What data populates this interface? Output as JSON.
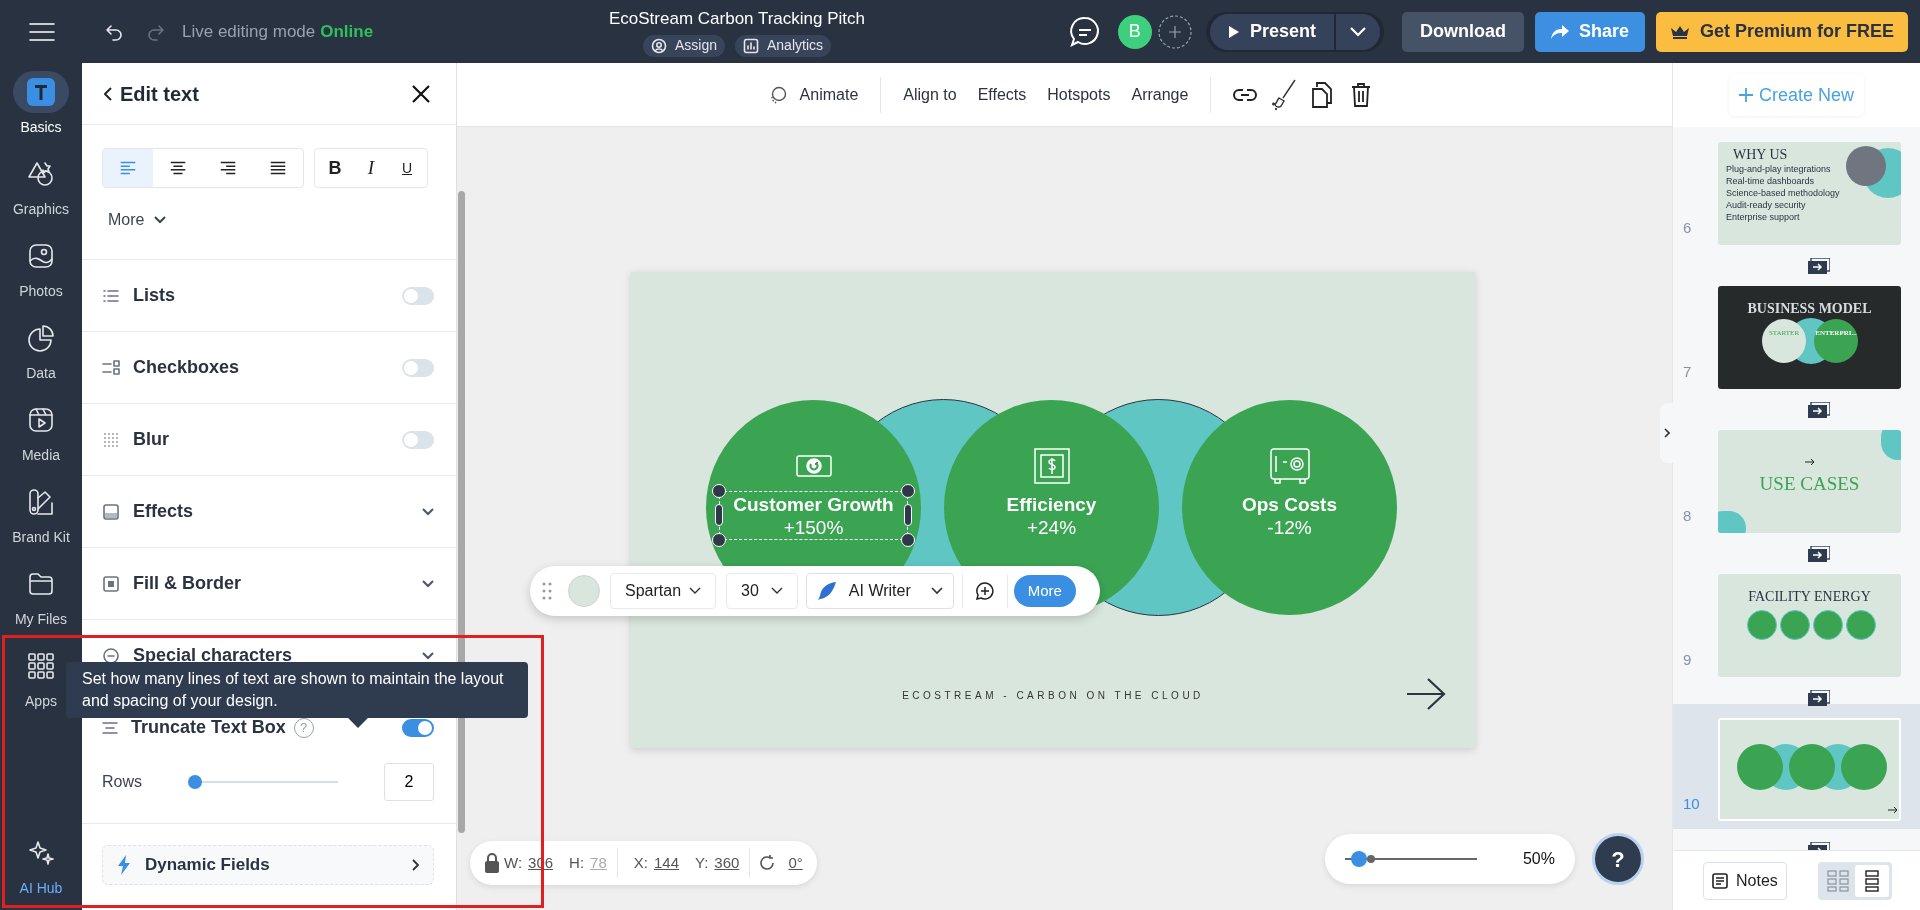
{
  "topbar": {
    "live_label": "Live editing mode",
    "live_status": "Online",
    "title": "EcoStream Carbon Tracking Pitch",
    "chips": [
      "Assign",
      "Analytics"
    ],
    "avatar": "B",
    "present": "Present",
    "download": "Download",
    "share": "Share",
    "premium": "Get Premium for FREE"
  },
  "rail": [
    {
      "label": "Basics",
      "selected": true
    },
    {
      "label": "Graphics",
      "selected": false
    },
    {
      "label": "Photos",
      "selected": false
    },
    {
      "label": "Data",
      "selected": false
    },
    {
      "label": "Media",
      "selected": false
    },
    {
      "label": "Brand Kit",
      "selected": false
    },
    {
      "label": "My Files",
      "selected": false
    },
    {
      "label": "Apps",
      "selected": false
    },
    {
      "label": "AI Hub",
      "selected": false
    }
  ],
  "panel": {
    "title": "Edit text",
    "align_buttons": [
      {
        "selected": true
      },
      {
        "selected": false
      },
      {
        "selected": false
      },
      {
        "selected": false
      }
    ],
    "style_buttons": [
      "B",
      "I",
      "U"
    ],
    "more": "More",
    "sections": [
      {
        "kind": "toggle",
        "label": "Lists",
        "on": false
      },
      {
        "kind": "toggle",
        "label": "Checkboxes",
        "on": false
      },
      {
        "kind": "toggle",
        "label": "Blur",
        "on": false
      },
      {
        "kind": "expand",
        "label": "Effects"
      },
      {
        "kind": "expand",
        "label": "Fill & Border"
      },
      {
        "kind": "expand",
        "label": "Special characters"
      }
    ],
    "truncate": {
      "label": "Truncate Text Box",
      "help": "?",
      "on": true
    },
    "rows": {
      "label": "Rows",
      "level": 0,
      "value": "2"
    },
    "dynamic_fields": "Dynamic Fields"
  },
  "tooltip": "Set how many lines of text are shown to maintain the layout and spacing of your design.",
  "toolbar": {
    "animate": "Animate",
    "items": [
      "Align to",
      "Effects",
      "Hotspots",
      "Arrange"
    ]
  },
  "slide": {
    "stats": [
      {
        "title": "Customer Growth",
        "value": "+150%",
        "selected": true
      },
      {
        "title": "Efficiency",
        "value": "+24%",
        "selected": false
      },
      {
        "title": "Ops Costs",
        "value": "-12%",
        "selected": false
      }
    ],
    "footer": "ECOSTREAM - CARBON ON THE CLOUD"
  },
  "text_toolbar": {
    "font": "Spartan",
    "size": "30",
    "ai": "AI Writer",
    "more": "More"
  },
  "geometry": [
    {
      "label": "W:",
      "value": "306",
      "disabled": false
    },
    {
      "label": "H:",
      "value": "78",
      "disabled": true
    },
    {
      "label": "X:",
      "value": "144",
      "disabled": false
    },
    {
      "label": "Y:",
      "value": "360",
      "disabled": false
    }
  ],
  "rotation": "0°",
  "zoom": {
    "level": 0.05,
    "reading": "50%"
  },
  "help": "?",
  "slides_panel": {
    "create": "Create New",
    "slides": [
      {
        "number": "6",
        "selected": false,
        "kind": "why_us",
        "title": "WHY US",
        "lines": [
          "Plug-and-play integrations",
          "Real-time dashboards",
          "Science-based methodology",
          "Audit-ready security",
          "Enterprise support"
        ]
      },
      {
        "number": "7",
        "selected": false,
        "kind": "business",
        "title": "BUSINESS MODEL",
        "labels": [
          "STARTER",
          "ENTERPRI..."
        ]
      },
      {
        "number": "8",
        "selected": false,
        "kind": "title",
        "title": "USE CASES"
      },
      {
        "number": "9",
        "selected": false,
        "kind": "facility",
        "title": "FACILITY ENERGY"
      },
      {
        "number": "10",
        "selected": true,
        "kind": "circles"
      }
    ],
    "notes": "Notes",
    "views": [
      {
        "selected": false
      },
      {
        "selected": true
      }
    ]
  }
}
